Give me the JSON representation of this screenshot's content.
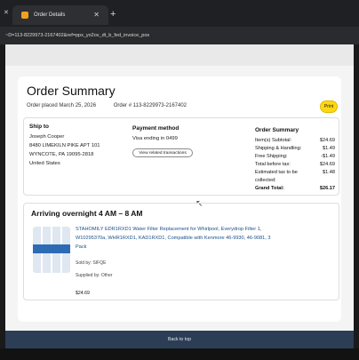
{
  "browser": {
    "tab_title": "Order Details",
    "url": "~D=113-8229973-2167402&ref=ppx_yo2ov_dt_b_fed_invoice_pos"
  },
  "order": {
    "title": "Order Summary",
    "placed": "Order placed March 25, 2026",
    "number": "Order # 113-8229973-2167402",
    "print_label": "Print"
  },
  "ship_to": {
    "heading": "Ship to",
    "name": "Joseph Cooper",
    "line1": "8480 LIMEKILN PIKE APT 101",
    "line2": "WYNCOTE, PA 19095-2818",
    "country": "United States"
  },
  "payment": {
    "heading": "Payment method",
    "card": "Visa ending in 0499",
    "view_btn": "View related transactions"
  },
  "summary": {
    "heading": "Order Summary",
    "rows": [
      {
        "label": "Item(s) Subtotal:",
        "value": "$24.69"
      },
      {
        "label": "Shipping & Handling:",
        "value": "$1.49"
      },
      {
        "label": "Free Shipping:",
        "value": "-$1.49"
      },
      {
        "label": "Total before tax:",
        "value": "$24.69"
      },
      {
        "label": "Estimated tax to be",
        "value": "$1.48"
      },
      {
        "label": "collected:",
        "value": ""
      },
      {
        "label": "Grand Total:",
        "value": "$26.17"
      }
    ]
  },
  "shipment": {
    "arriving": "Arriving overnight 4 AM – 8 AM",
    "product_title": "STAHOMILY EDR1RXD1 Water Filter Replacement for Whirlpool, Everydrop Filter 1, W10295370a, WHR1RXD1, KAD1RXD1, Compatible with Kenmore 46-9930, 46-9081, 3 Pack",
    "sold_by": "Sold by: SIFQE",
    "supplied_by": "Supplied by: Other",
    "price": "$24.69"
  },
  "footer": {
    "back_to_top": "Back to top"
  }
}
